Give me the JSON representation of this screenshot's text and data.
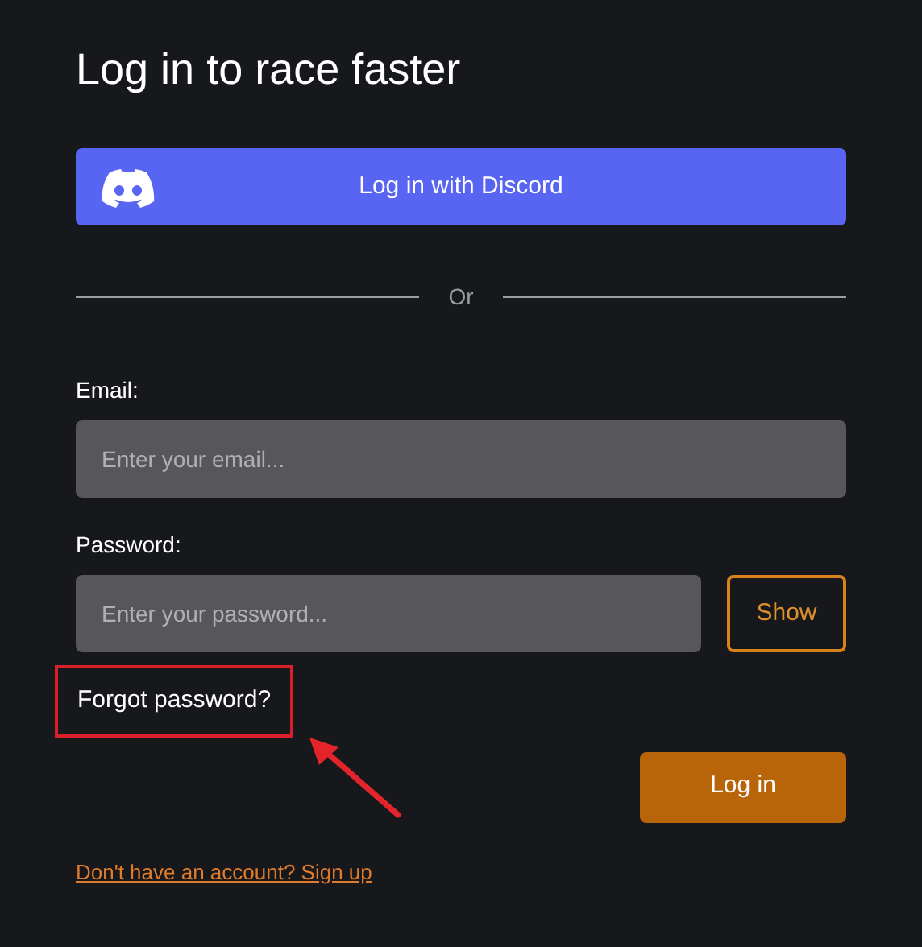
{
  "title": "Log in to race faster",
  "discord_button": {
    "label": "Log in with Discord"
  },
  "divider": {
    "label": "Or"
  },
  "email": {
    "label": "Email:",
    "placeholder": "Enter your email..."
  },
  "password": {
    "label": "Password:",
    "placeholder": "Enter your password...",
    "toggle": "Show"
  },
  "forgot_password": {
    "label": "Forgot password?",
    "highlighted": true
  },
  "submit_button": {
    "label": "Log in"
  },
  "signup_link": {
    "label": "Don't have an account? Sign up"
  }
}
